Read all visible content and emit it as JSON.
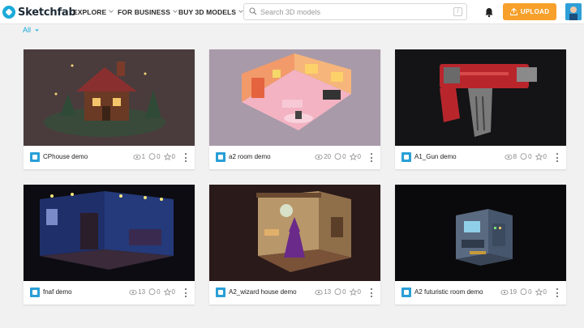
{
  "header": {
    "brand": "Sketchfab",
    "nav": [
      {
        "label": "EXPLORE"
      },
      {
        "label": "FOR BUSINESS"
      },
      {
        "label": "BUY 3D MODELS"
      }
    ],
    "search_placeholder": "Search 3D models",
    "search_shortcut": "/",
    "upload_label": "UPLOAD",
    "accent_color": "#1caad9",
    "upload_color": "#f7a02c"
  },
  "filter": {
    "label": "All"
  },
  "models": [
    {
      "title": "CPhouse demo",
      "views": "1",
      "comments": "0",
      "likes": "0"
    },
    {
      "title": "a2 room demo",
      "views": "20",
      "comments": "0",
      "likes": "0"
    },
    {
      "title": "A1_Gun demo",
      "views": "8",
      "comments": "0",
      "likes": "0"
    },
    {
      "title": "fnaf demo",
      "views": "13",
      "comments": "0",
      "likes": "0"
    },
    {
      "title": "A2_wizard house demo",
      "views": "13",
      "comments": "0",
      "likes": "0"
    },
    {
      "title": "A2 futuristic room demo",
      "views": "19",
      "comments": "0",
      "likes": "0"
    }
  ]
}
